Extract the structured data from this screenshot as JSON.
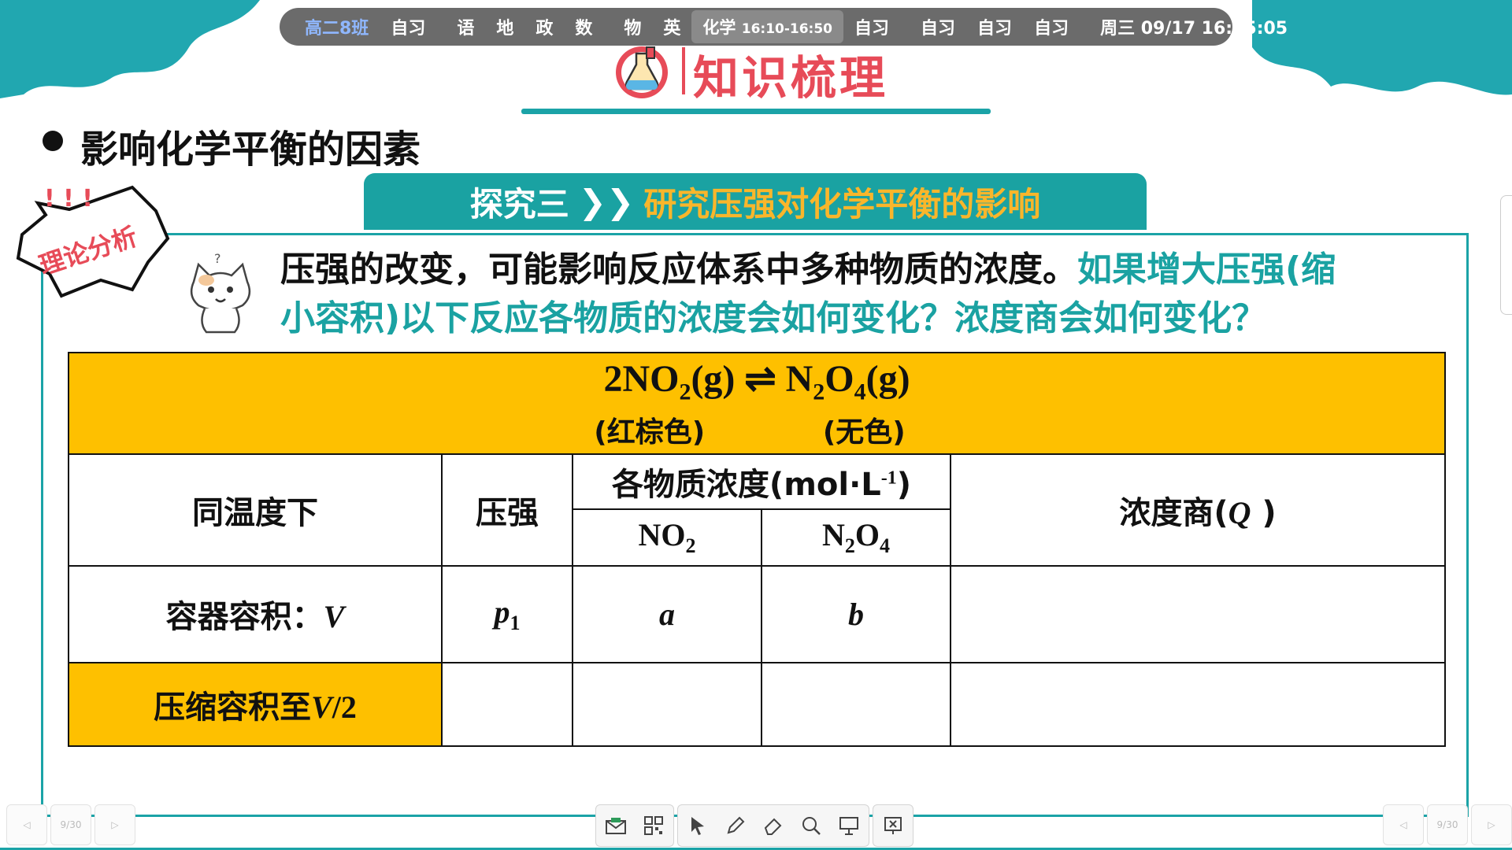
{
  "schedule": {
    "class_name": "高二8班",
    "slots": [
      "自习",
      "语",
      "地",
      "政",
      "数",
      "物",
      "英"
    ],
    "active": {
      "subject": "化学",
      "time": "16:10-16:50"
    },
    "after": [
      "自习",
      "自习",
      "自习",
      "自习"
    ],
    "clock": "周三 09/17  16:35:05"
  },
  "header": {
    "title": "知识梳理"
  },
  "section": {
    "heading": "影响化学平衡的因素"
  },
  "banner": {
    "left": "探究三",
    "arrow": "❯❯",
    "right": "研究压强对化学平衡的影响"
  },
  "sticker": {
    "label": "理论分析"
  },
  "paragraph": {
    "black": "压强的改变，可能影响反应体系中多种物质的浓度。",
    "teal": "如果增大压强(缩小容积)以下反应各物质的浓度会如何变化？浓度商会如何变化？"
  },
  "table": {
    "equation": {
      "left_coef": "2NO",
      "left_sub": "2",
      "left_state": "(g)",
      "arrow": "⇌",
      "right_n": "N",
      "right_sub1": "2",
      "right_o": "O",
      "right_sub2": "4",
      "right_state": "(g)",
      "left_color": "(红棕色)",
      "right_color": "(无色)"
    },
    "headers": {
      "condition": "同温度下",
      "pressure": "压强",
      "conc_group": "各物质浓度(mol·L",
      "conc_unit_exp": "-1",
      "conc_group_end": ")",
      "no2": "NO",
      "no2_sub": "2",
      "n2o4_n": "N",
      "n2o4_sub1": "2",
      "n2o4_o": "O",
      "n2o4_sub2": "4",
      "quotient": "浓度商(",
      "quotient_symbol": "Q",
      "quotient_end": " )"
    },
    "row1": {
      "condition": "容器容积：",
      "condition_var": "V",
      "pressure": "p",
      "pressure_sub": "1",
      "no2": "a",
      "n2o4": "b",
      "q": ""
    },
    "row2": {
      "condition": "压缩容积至",
      "condition_var": "V",
      "condition_suffix": "/2",
      "pressure": "",
      "no2": "",
      "n2o4": "",
      "q": ""
    }
  },
  "nav": {
    "page": "9/30"
  },
  "colors": {
    "teal": "#1aa2a2",
    "yellow": "#fec000",
    "red": "#e74b58"
  }
}
